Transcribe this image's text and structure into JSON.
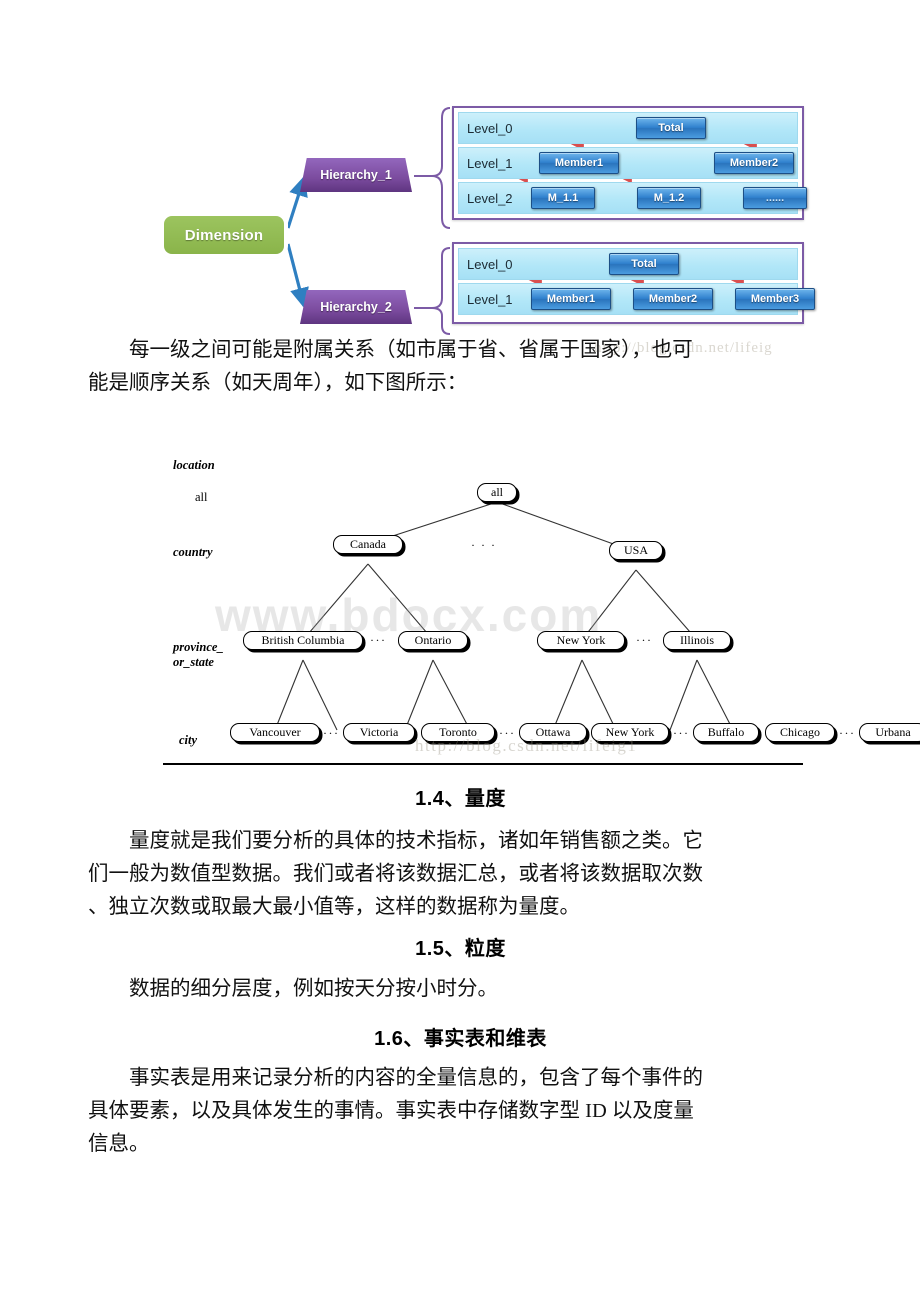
{
  "figure1": {
    "dimension_label": "Dimension",
    "hierarchies": [
      {
        "name": "Hierarchy_1",
        "rows": [
          {
            "level": "Level_0",
            "members": [
              "Total"
            ]
          },
          {
            "level": "Level_1",
            "members": [
              "Member1",
              "Member2"
            ]
          },
          {
            "level": "Level_2",
            "members": [
              "M_1.1",
              "M_1.2",
              "......"
            ]
          }
        ]
      },
      {
        "name": "Hierarchy_2",
        "rows": [
          {
            "level": "Level_0",
            "members": [
              "Total"
            ]
          },
          {
            "level": "Level_1",
            "members": [
              "Member1",
              "Member2",
              "Member3"
            ]
          }
        ]
      }
    ],
    "watermark": "http://blog.csdn.net/lifeig",
    "colors": {
      "dimension_green": "#8ab44a",
      "hierarchy_purple": "#7b4b9e",
      "level_row_blue": "#b2e7f8",
      "member_button_blue": "#2f80cd",
      "flow_arrow_red": "#e05a5a",
      "box_border_purple": "#7c5ba6"
    }
  },
  "paragraph1": {
    "line1": "每一级之间可能是附属关系（如市属于省、省属于国家），也可",
    "line2": "能是顺序关系（如天周年），如下图所示："
  },
  "figure2": {
    "title": "location",
    "level_labels": [
      "all",
      "country",
      "province_",
      "or_state",
      "city"
    ],
    "nodes": {
      "all": "all",
      "countries": [
        "Canada",
        "USA"
      ],
      "country_gap": "· · ·",
      "provinces": [
        "British Columbia",
        "Ontario",
        "New York",
        "Illinois"
      ],
      "province_gaps": [
        "···",
        "···"
      ],
      "cities": [
        "Vancouver",
        "Victoria",
        "Toronto",
        "Ottawa",
        "New York",
        "Buffalo",
        "Chicago",
        "Urbana"
      ],
      "city_gaps": [
        "···",
        "···",
        "···",
        "···"
      ]
    },
    "watermark_bdocx": "www.bdocx.com",
    "watermark_csdn": "http://blog.csdn.net/lifeig1"
  },
  "sections": [
    {
      "heading": "1.4、量度",
      "lines": [
        "量度就是我们要分析的具体的技术指标，诸如年销售额之类。它",
        "们一般为数值型数据。我们或者将该数据汇总，或者将该数据取次数",
        "、独立次数或取最大最小值等，这样的数据称为量度。"
      ]
    },
    {
      "heading": "1.5、粒度",
      "lines": [
        "数据的细分层度，例如按天分按小时分。"
      ]
    },
    {
      "heading": "1.6、事实表和维表",
      "lines": [
        "事实表是用来记录分析的内容的全量信息的，包含了每个事件的",
        "具体要素，以及具体发生的事情。事实表中存储数字型 ID 以及度量",
        "信息。"
      ]
    }
  ]
}
